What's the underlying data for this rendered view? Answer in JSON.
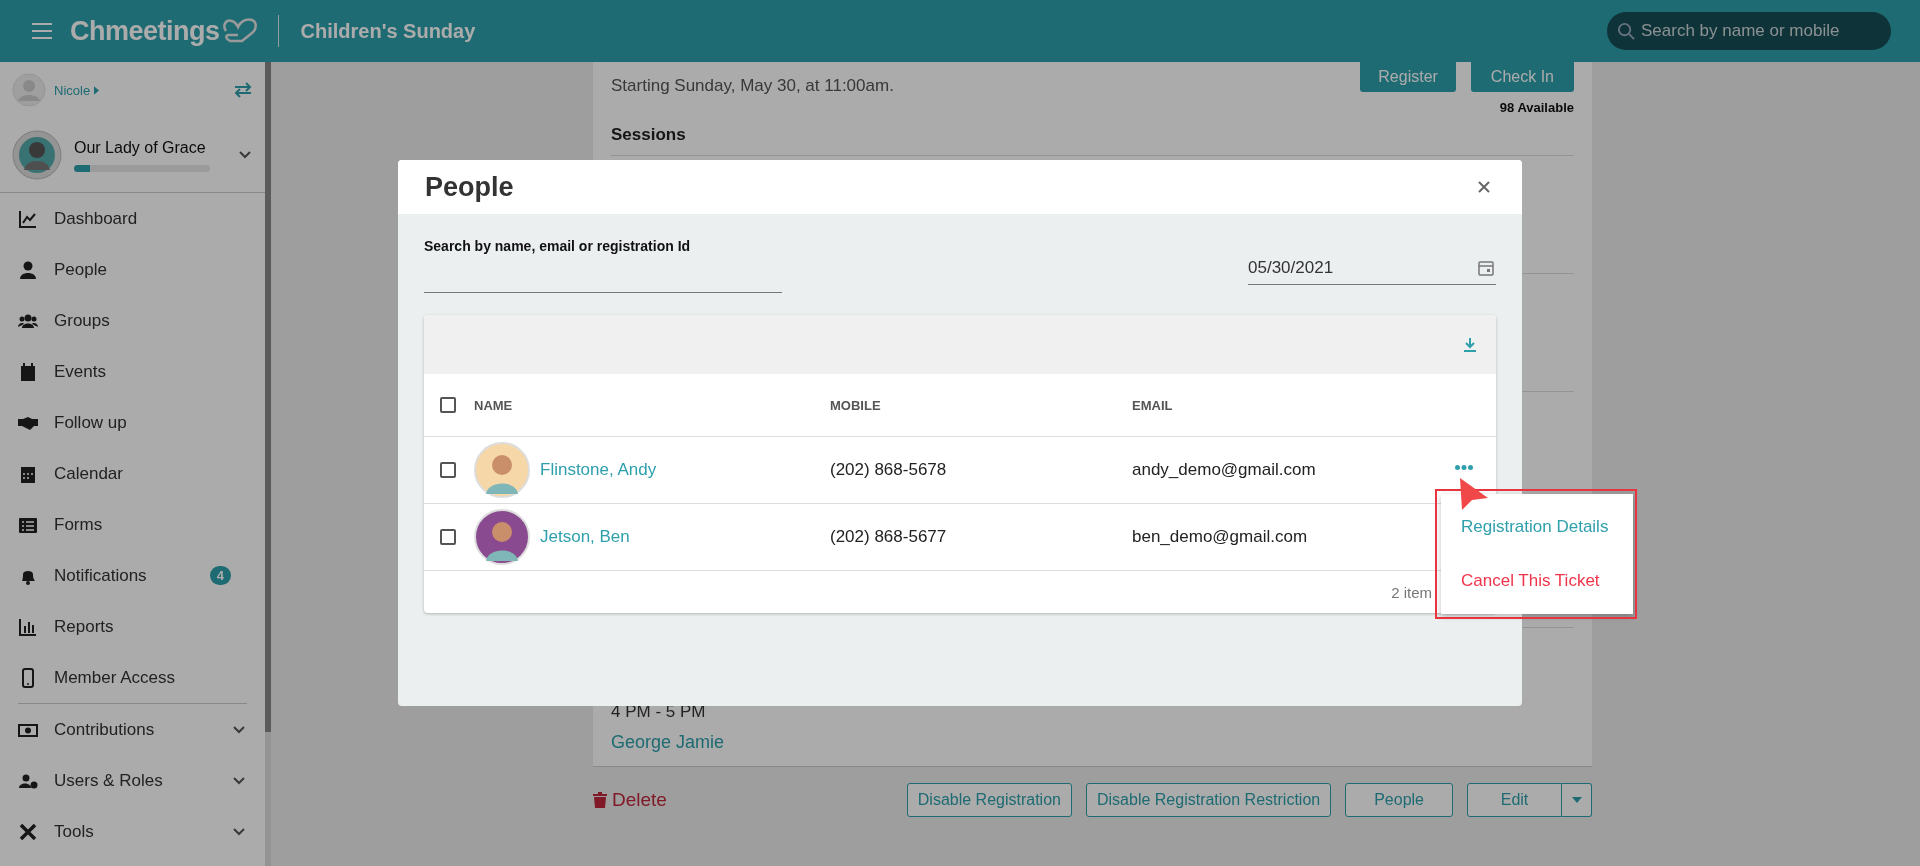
{
  "header": {
    "brand": "Chmeetings",
    "title": "Children's Sunday",
    "search": {
      "placeholder": "Search by name or mobile"
    }
  },
  "sidebar": {
    "user": "Nicole",
    "church": {
      "name": "Our Lady of Grace",
      "level": 0.12
    },
    "items": [
      {
        "label": "Dashboard",
        "expandable": false
      },
      {
        "label": "People",
        "expandable": false
      },
      {
        "label": "Groups",
        "expandable": false
      },
      {
        "label": "Events",
        "expandable": false
      },
      {
        "label": "Follow up",
        "expandable": false
      },
      {
        "label": "Calendar",
        "expandable": false
      },
      {
        "label": "Forms",
        "expandable": false
      },
      {
        "label": "Notifications",
        "expandable": false,
        "badge": "4"
      },
      {
        "label": "Reports",
        "expandable": false
      },
      {
        "label": "Member Access",
        "expandable": false
      },
      {
        "label": "Contributions",
        "expandable": true
      },
      {
        "label": "Users & Roles",
        "expandable": true
      },
      {
        "label": "Tools",
        "expandable": true
      }
    ]
  },
  "event": {
    "description": "Starting Sunday, May 30, at 11:00am.",
    "buttons": [
      "Register",
      "Check In"
    ],
    "available": "98 Available",
    "sessions_heading": "Sessions",
    "session_time": "4 PM - 5 PM",
    "session_leader": "George Jamie",
    "delete": "Delete",
    "actions": [
      "Disable Registration",
      "Disable Registration Restriction",
      "People"
    ],
    "edit": "Edit"
  },
  "modal": {
    "title": "People",
    "search_label": "Search by name, email or registration Id",
    "date": "05/30/2021",
    "table": {
      "columns": [
        "NAME",
        "MOBILE",
        "EMAIL"
      ],
      "all_checked": false,
      "rows": [
        {
          "name": "Flinstone, Andy",
          "mobile": "(202) 868-5678",
          "email": "andy_demo@gmail.com",
          "checked": false,
          "color": "#f6d7a7"
        },
        {
          "name": "Jetson, Ben",
          "mobile": "(202) 868-5677",
          "email": "ben_demo@gmail.com",
          "checked": false,
          "color": "#8a4a8f"
        }
      ],
      "footer": "2 item"
    },
    "menu": [
      {
        "label": "Registration Details",
        "kind": "link"
      },
      {
        "label": "Cancel This Ticket",
        "kind": "danger"
      }
    ]
  }
}
